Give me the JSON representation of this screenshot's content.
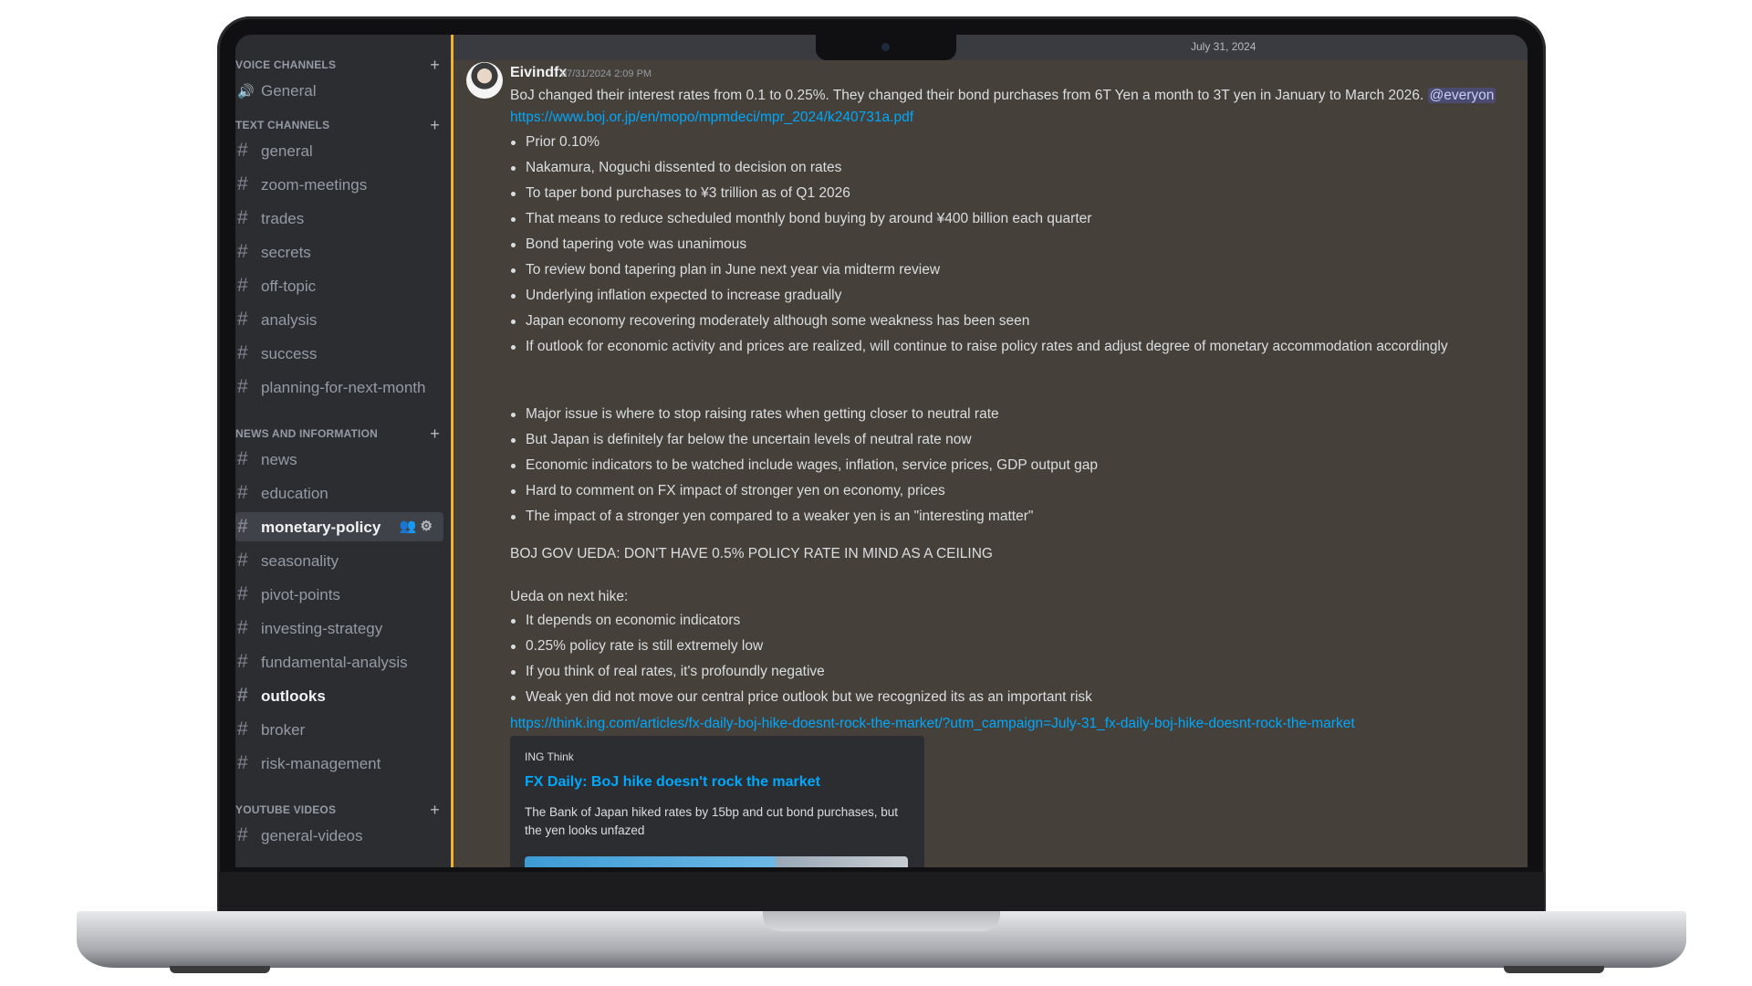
{
  "date_divider": "July 31, 2024",
  "sidebar": {
    "categories": [
      {
        "label": "VOICE CHANNELS",
        "plus": "+"
      },
      {
        "label": "TEXT CHANNELS",
        "plus": "+"
      },
      {
        "label": "NEWS AND INFORMATION",
        "plus": "+"
      },
      {
        "label": "YOUTUBE VIDEOS",
        "plus": "+"
      }
    ],
    "voice_channels": [
      "General"
    ],
    "text_channels": [
      "general",
      "zoom-meetings",
      "trades",
      "secrets",
      "off-topic",
      "analysis",
      "success",
      "planning-for-next-month"
    ],
    "news_channels": [
      "news",
      "education",
      "monetary-policy",
      "seasonality",
      "pivot-points",
      "investing-strategy",
      "fundamental-analysis",
      "outlooks",
      "broker",
      "risk-management"
    ],
    "youtube_channels": [
      "general-videos"
    ],
    "active_channel": "monetary-policy",
    "unread_channel": "outlooks"
  },
  "message": {
    "author": "Eivindfx",
    "timestamp": "07/31/2024 2:09 PM",
    "intro": "BoJ changed their interest rates from 0.1 to 0.25%. They changed their bond purchases from 6T Yen a month to 3T yen in January to March 2026.",
    "mention": "@everyon",
    "link1": "https://www.boj.or.jp/en/mopo/mpmdeci/mpr_2024/k240731a.pdf",
    "bullets1": [
      "Prior 0.10%",
      "Nakamura, Noguchi dissented to decision on rates",
      "To taper bond purchases to ¥3 trillion as of Q1 2026",
      "That means to reduce scheduled monthly bond buying by around ¥400 billion each quarter",
      "Bond tapering vote was unanimous",
      "To review bond tapering plan in June next year via midterm review",
      "Underlying inflation expected to increase gradually",
      "Japan economy recovering moderately although some weakness has been seen",
      "If outlook for economic activity and prices are realized, will continue to raise policy rates and adjust degree of monetary accommodation accordingly"
    ],
    "bullets2": [
      "Major issue is where to stop raising rates when getting closer to neutral rate",
      "But Japan is definitely far below the uncertain levels of neutral rate now",
      "Economic indicators to be watched include wages, inflation, service prices, GDP output gap",
      "Hard to comment on FX impact of stronger yen on economy, prices",
      "The impact of a stronger yen compared to a weaker yen is an \"interesting matter\""
    ],
    "headline": "BOJ GOV UEDA: DON'T HAVE 0.5% POLICY RATE IN MIND AS A CEILING",
    "subhead": "Ueda on next hike:",
    "bullets3": [
      "It depends on economic indicators",
      "0.25% policy rate is still extremely low",
      "If you think of real rates, it's profoundly negative",
      "Weak yen did not move our central price outlook but we recognized its as an important risk"
    ],
    "link2": "https://think.ing.com/articles/fx-daily-boj-hike-doesnt-rock-the-market/?utm_campaign=July-31_fx-daily-boj-hike-doesnt-rock-the-market",
    "embed": {
      "provider": "ING Think",
      "title": "FX Daily: BoJ hike doesn't rock the market",
      "description": "The Bank of Japan hiked rates by 15bp and cut bond purchases, but the yen looks unfazed"
    }
  },
  "colors": {
    "accent_link": "#00a8fc",
    "highlight_bar": "#f0b232",
    "sidebar_bg": "#2b2d31"
  }
}
